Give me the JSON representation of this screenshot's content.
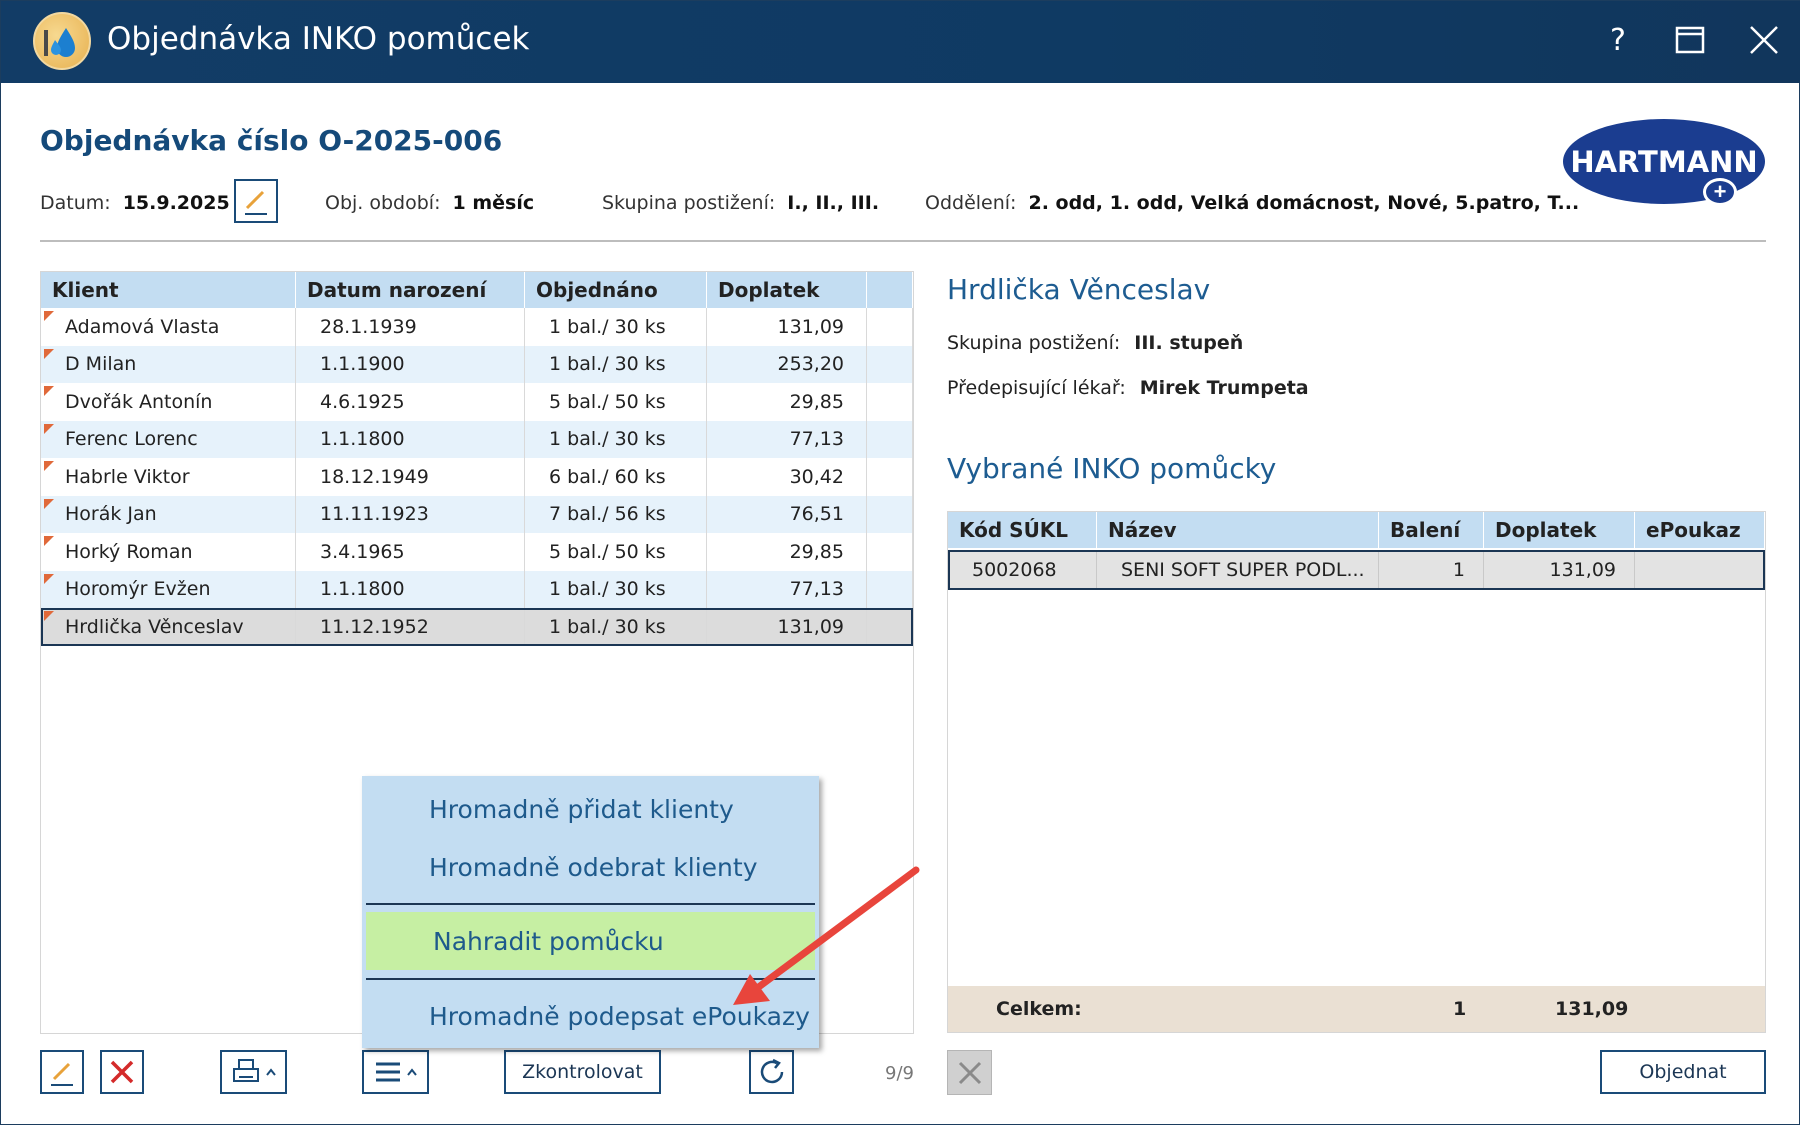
{
  "window": {
    "title": "Objednávka INKO pomůcek",
    "help": "?",
    "maximize": "☐",
    "close": "✕"
  },
  "order": {
    "title": "Objednávka číslo O-2025-006",
    "date_label": "Datum:",
    "date_value": "15.9.2025",
    "period_label": "Obj. období:",
    "period_value": "1 měsíc",
    "group_label": "Skupina postižení:",
    "group_value": "I., II., III.",
    "dept_label": "Oddělení:",
    "dept_value": "2. odd, 1. odd, Velká domácnost, Nové, 5.patro, T..."
  },
  "logo": {
    "text": "HARTMANN",
    "plus": "+"
  },
  "client_table": {
    "headers": [
      "Klient",
      "Datum narození",
      "Objednáno",
      "Doplatek",
      ""
    ],
    "rows": [
      {
        "name": "Adamová Vlasta",
        "birth": "28.1.1939",
        "ordered": "1 bal./ 30 ks",
        "copay": "131,09"
      },
      {
        "name": "D Milan",
        "birth": "1.1.1900",
        "ordered": "1 bal./ 30 ks",
        "copay": "253,20"
      },
      {
        "name": "Dvořák Antonín",
        "birth": "4.6.1925",
        "ordered": "5 bal./ 50 ks",
        "copay": "29,85"
      },
      {
        "name": "Ferenc Lorenc",
        "birth": "1.1.1800",
        "ordered": "1 bal./ 30 ks",
        "copay": "77,13"
      },
      {
        "name": "Habrle Viktor",
        "birth": "18.12.1949",
        "ordered": "6 bal./ 60 ks",
        "copay": "30,42"
      },
      {
        "name": "Horák Jan",
        "birth": "11.11.1923",
        "ordered": "7 bal./ 56 ks",
        "copay": "76,51"
      },
      {
        "name": "Horký Roman",
        "birth": "3.4.1965",
        "ordered": "5 bal./ 50 ks",
        "copay": "29,85"
      },
      {
        "name": "Horomýr Evžen",
        "birth": "1.1.1800",
        "ordered": "1 bal./ 30 ks",
        "copay": "77,13"
      },
      {
        "name": "Hrdlička Věnceslav",
        "birth": "11.12.1952",
        "ordered": "1 bal./ 30 ks",
        "copay": "131,09"
      }
    ]
  },
  "detail": {
    "client_name": "Hrdlička Věnceslav",
    "group_label": "Skupina postižení:",
    "group_value": "III. stupeň",
    "doctor_label": "Předepisující lékař:",
    "doctor_value": "Mirek Trumpeta",
    "section_title": "Vybrané INKO pomůcky"
  },
  "aid_table": {
    "headers": [
      "Kód SÚKL",
      "Název",
      "Balení",
      "Doplatek",
      "ePoukaz"
    ],
    "rows": [
      {
        "code": "5002068",
        "name": "SENI SOFT SUPER PODL...",
        "packs": "1",
        "copay": "131,09",
        "epoukaz": ""
      }
    ],
    "total_label": "Celkem:",
    "total_packs": "1",
    "total_copay": "131,09"
  },
  "menu": {
    "items": [
      "Hromadně přidat klienty",
      "Hromadně odebrat klienty",
      "Nahradit pomůcku",
      "Hromadně podepsat ePoukazy"
    ]
  },
  "toolbar": {
    "check_label": "Zkontrolovat",
    "counter": "9/9",
    "order_label": "Objednat"
  },
  "colors": {
    "accent": "#1b3654",
    "header_bg": "#c3ddf2",
    "menu_highlight": "#c6efa3",
    "arrow": "#e8453c"
  }
}
